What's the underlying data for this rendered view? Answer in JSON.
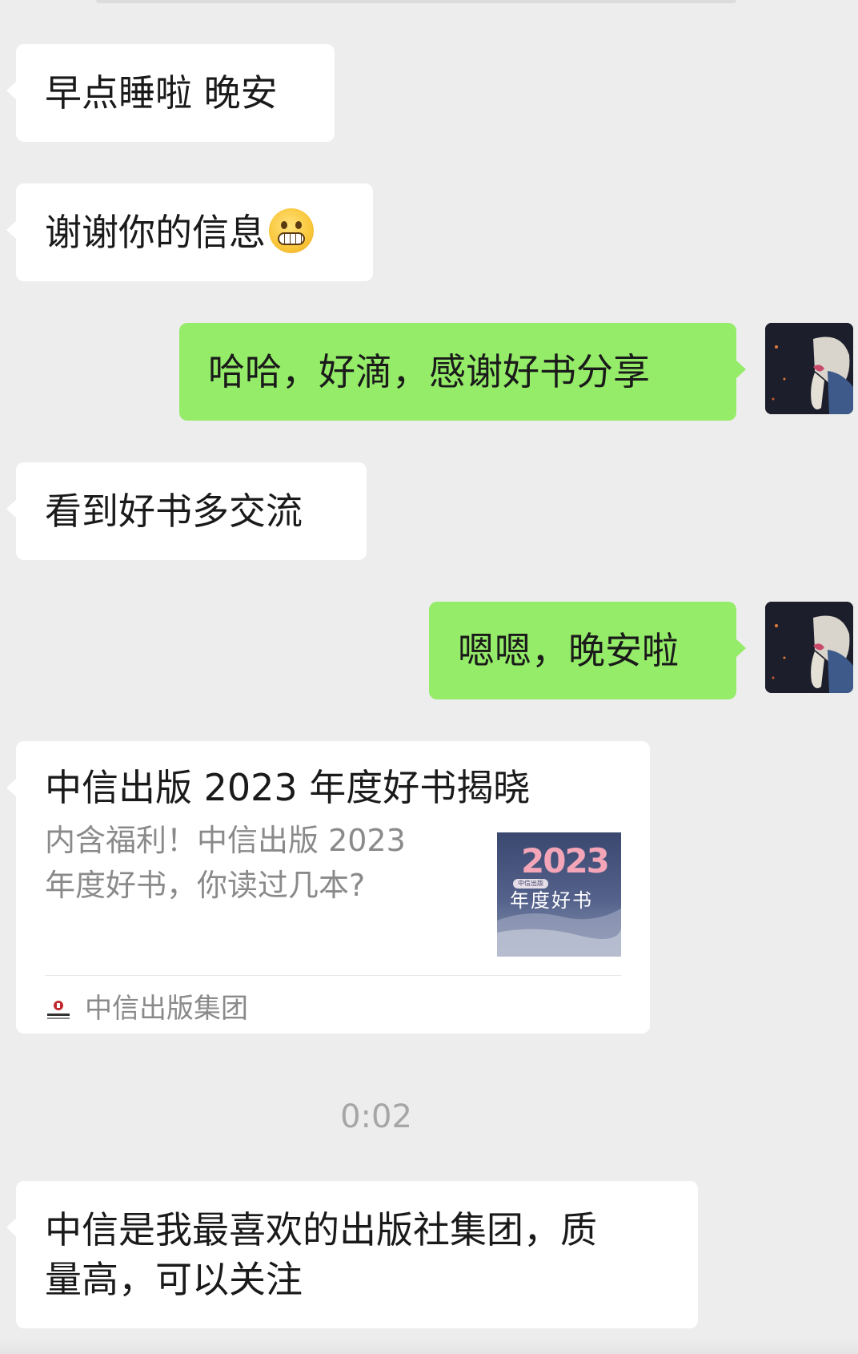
{
  "messages": [
    {
      "side": "in",
      "text": "早点睡啦 晚安"
    },
    {
      "side": "in",
      "text": "谢谢你的信息",
      "emoji": "grinning-face-emoji"
    },
    {
      "side": "out",
      "text": "哈哈，好滴，感谢好书分享"
    },
    {
      "side": "in",
      "text": "看到好书多交流"
    },
    {
      "side": "out",
      "text": "嗯嗯，晚安啦"
    },
    {
      "side": "in",
      "text_line1": "中信是我最喜欢的出版社集团，质",
      "text_line2": "量高，可以关注"
    }
  ],
  "link_card": {
    "title": "中信出版 2023 年度好书揭晓",
    "desc_line1": "内含福利！中信出版 2023",
    "desc_line2": "年度好书，你读过几本?",
    "thumb_year": "2023",
    "thumb_tag": "中信出版",
    "thumb_subtitle": "年度好书",
    "source": "中信出版集团",
    "source_icon": "citic-logo-icon"
  },
  "timestamp": "0:02",
  "colors": {
    "background": "#ededed",
    "incoming_bubble": "#ffffff",
    "outgoing_bubble": "#95ec69",
    "timestamp_text": "#a6a6a6"
  }
}
